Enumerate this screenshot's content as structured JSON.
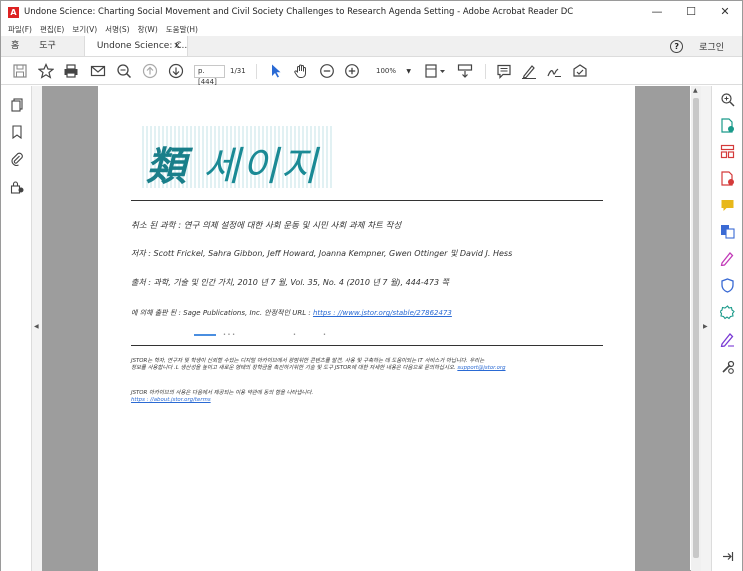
{
  "window": {
    "title": "Undone Science: Charting Social Movement and Civil Society Challenges to Research Agenda Setting - Adobe Acrobat Reader DC",
    "controls": [
      "minimize",
      "maximize",
      "close"
    ]
  },
  "menubar": {
    "items": [
      "파일(F)",
      "편집(E)",
      "보기(V)",
      "서명(S)",
      "창(W)",
      "도움말(H)"
    ]
  },
  "tabs": {
    "home": "홈",
    "tools": "도구",
    "document": "Undone Science: C...",
    "close": "×",
    "help": "?",
    "login": "로그인"
  },
  "toolbar": {
    "page_value": "p. [444]",
    "page_total": "1/31",
    "zoom": "100%",
    "icons": [
      "save-icon",
      "bookmark-star-icon",
      "print-icon",
      "email-icon",
      "search-icon",
      "page-up-icon",
      "page-down-icon",
      "select-cursor-icon",
      "hand-icon",
      "zoom-out-icon",
      "zoom-in-icon",
      "fit-page-icon",
      "scroll-mode-icon",
      "comment-icon",
      "highlight-pen-icon",
      "sign-icon",
      "share-icon"
    ]
  },
  "document": {
    "logo_hanja": "類",
    "logo_text": "세이지",
    "line1": "취소 된 과학 : 연구 의제 설정에 대한 사회 운동 및 시민 사회 과제 차트 작성",
    "line2": "저자 : Scott Frickel, Sahra Gibbon, Jeff Howard, Joanna Kempner, Gwen Ottinger 및 David J. Hess",
    "line3": "출처 : 과학, 기술 및 인간 가치, 2010 년 7 월, Vol. 35, No. 4 (2010 년 7 월), 444-473 쪽",
    "line4_prefix": "에 의해 출판 된 : Sage Publications, Inc. 안정적인 URL :",
    "line4_link": "https : //www.jstor.org/stable/27862473",
    "small1": "JSTOR는 학자, 연구자 및 학생이 신뢰할 수있는 디지털 아카이브에서 광범위한 콘텐츠를 발견, 사용 및 구축하는 데 도움이되는 IT 서비스가 아닙니다. 우리는",
    "small2_prefix": "정보를 사용합니다 .L 생산성을 높이고 새로운 형태의 장학금을 촉진하기위한 기술 및 도구 JSTOR에 대한 자세한 내용은 다음으로 문의하십시오.",
    "small2_link": "support@jstor.org",
    "small3": "JSTOR 아카이브의 사용은 다음에서 제공되는 이용 약관에 동의 함을 나타냅니다.",
    "small4_link": "https : //about.jstor.org/terms"
  },
  "right_panel_icons": [
    "zoom-icon",
    "export-pdf-icon",
    "organize-pages-icon",
    "create-pdf-icon",
    "comment-tool-icon",
    "translate-icon",
    "fill-sign-icon",
    "protect-icon",
    "enhance-scan-icon",
    "signature-icon",
    "more-tools-icon",
    "expand-icon"
  ],
  "left_panel_icons": [
    "thumbnails-icon",
    "bookmark-icon",
    "attachment-icon",
    "lock-icon"
  ],
  "colors": {
    "accent_blue": "#2a6ad4",
    "logo_teal": "#1a8a95",
    "viewer_gray": "#9d9d9d"
  }
}
